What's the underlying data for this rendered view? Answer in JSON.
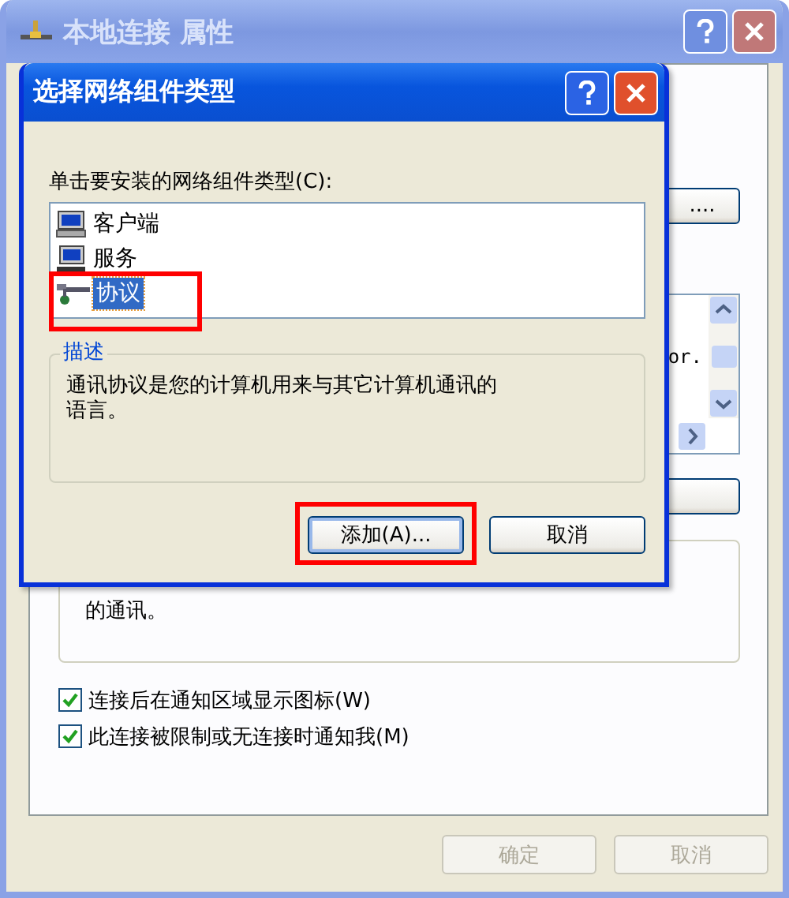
{
  "main_window": {
    "title": "本地连接 属性",
    "active": false,
    "partial_button_label": "....",
    "partial_list_text": "or.",
    "description_tail": "的通讯。",
    "checkboxes": [
      {
        "label": "连接后在通知区域显示图标(W)",
        "checked": true
      },
      {
        "label": "此连接被限制或无连接时通知我(M)",
        "checked": true
      }
    ],
    "buttons": [
      {
        "label": "确定",
        "disabled": true
      },
      {
        "label": "取消",
        "disabled": true
      }
    ]
  },
  "dialog": {
    "title": "选择网络组件类型",
    "active": true,
    "prompt": "单击要安装的网络组件类型(C):",
    "items": [
      {
        "label": "客户端",
        "kind": "client",
        "selected": false,
        "highlighted": false
      },
      {
        "label": "服务",
        "kind": "service",
        "selected": false,
        "highlighted": false
      },
      {
        "label": "协议",
        "kind": "protocol",
        "selected": true,
        "highlighted": true
      }
    ],
    "description_title": "描述",
    "description": "通讯协议是您的计算机用来与其它计算机通讯的语言。",
    "buttons": [
      {
        "label": "添加(A)...",
        "highlighted": true
      },
      {
        "label": "取消",
        "highlighted": false
      }
    ]
  }
}
